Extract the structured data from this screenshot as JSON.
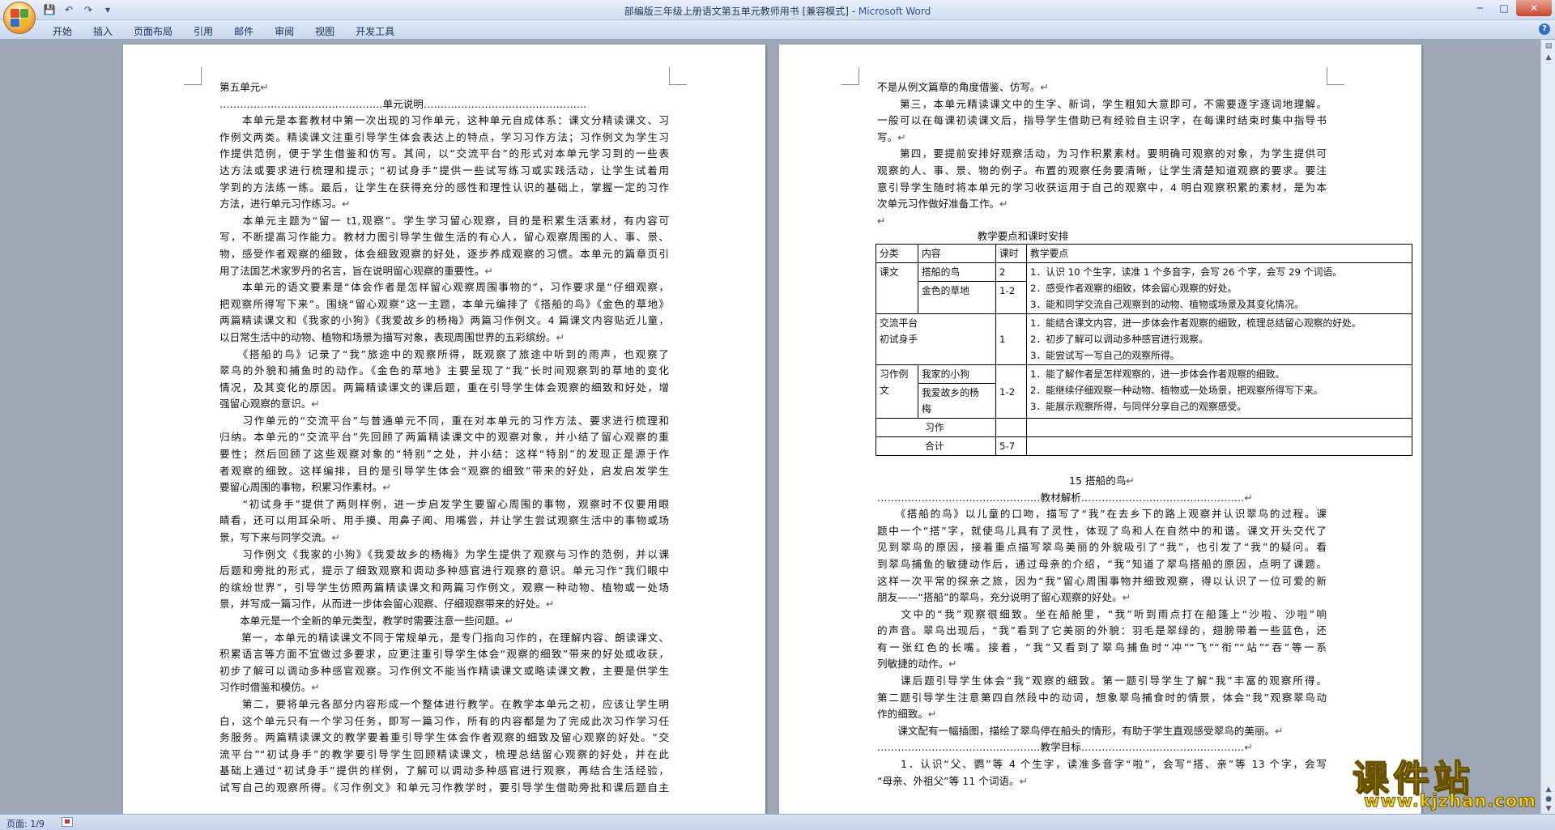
{
  "window": {
    "title_doc": "部编版三年级上册语文第五单元教师用书 [兼容模式] - ",
    "title_app": "Microsoft Word",
    "minimize": "─",
    "maximize": "□",
    "close": "✕"
  },
  "qat": {
    "save": "💾",
    "undo": "↶",
    "redo": "↷",
    "more": "▾"
  },
  "tabs": [
    "开始",
    "插入",
    "页面布局",
    "引用",
    "邮件",
    "审阅",
    "视图",
    "开发工具"
  ],
  "help": "?",
  "status": {
    "page": "页面: 1/9"
  },
  "watermark": {
    "text": "课件站",
    "url": "www.kjzhan.com"
  },
  "left_page": {
    "lines": [
      {
        "t": "第五单元",
        "c": "",
        "pm": true
      },
      {
        "t": "  …………………………………………单元说明…………………………………………",
        "c": "",
        "pm": false
      },
      {
        "t": "　　本单元是本套教材中第一次出现的习作单元，这种单元自成体系：课文分精读课文、习",
        "c": "jst",
        "pm": false
      },
      {
        "t": "作例文两类。精读课文注重引导学生体会表达上的特点，学习习作方法；习作例文为学生习",
        "c": "jst",
        "pm": false
      },
      {
        "t": "作提供范例，便于学生借鉴和仿写。其间，以“交流平台”的形式对本单元学习到的一些表",
        "c": "jst",
        "pm": false
      },
      {
        "t": "达方法或要求进行梳理和提示；“初试身手”提供一些试写练习或实践活动，让学生试着用",
        "c": "jst",
        "pm": false
      },
      {
        "t": "学到的方法练一练。最后，让学生在获得充分的感性和理性认识的基础上，掌握一定的习作",
        "c": "jst",
        "pm": false
      },
      {
        "t": "方法，进行单元习作练习。",
        "c": "",
        "pm": true
      },
      {
        "t": "　　本单元主题为“留一 t1,观察”。学生学习留心观察，目的是积累生活素材，有内容可",
        "c": "jst",
        "pm": false
      },
      {
        "t": "写，不断提高习作能力。教材力图引导学生做生活的有心人，留心观察周围的人、事、景、",
        "c": "jst",
        "pm": false
      },
      {
        "t": "物，感受作者观察的细致，体会细致观察的好处，逐步养成观察的习惯。本单元的篇章页引",
        "c": "jst",
        "pm": false
      },
      {
        "t": "用了法国艺术家罗丹的名言，旨在说明留心观察的重要性。",
        "c": "",
        "pm": true
      },
      {
        "t": "　　本单元的语文要素是“体会作者是怎样留心观察周围事物的”，习作要求是“仔细观察，",
        "c": "jst",
        "pm": false
      },
      {
        "t": "把观察所得写下来”。围绕“留心观察”这一主题，本单元编排了《搭船的鸟》《金色的草地》",
        "c": "jst",
        "pm": false
      },
      {
        "t": "两篇精读课文和《我家的小狗》《我爱故乡的杨梅》两篇习作例文。4 篇课文内容贴近儿童，",
        "c": "jst",
        "pm": false
      },
      {
        "t": "以日常生活中的动物、植物和场景为描写对象，表现周围世界的五彩缤纷。",
        "c": "",
        "pm": true
      },
      {
        "t": "　　《搭船的鸟》记录了“我”旅途中的观察所得，既观察了旅途中听到的雨声，也观察了",
        "c": "jst",
        "pm": false
      },
      {
        "t": "翠鸟的外貌和捕鱼时的动作。《金色的草地》主要呈现了“我”长时间观察到的草地的变化",
        "c": "jst",
        "pm": false
      },
      {
        "t": "情况，及其变化的原因。两篇精读课文的课后题，重在引导学生体会观察的细致和好处，增",
        "c": "jst",
        "pm": false
      },
      {
        "t": "强留心观察的意识。",
        "c": "",
        "pm": true
      },
      {
        "t": "　　习作单元的“交流平台”与普通单元不同，重在对本单元的习作方法、要求进行梳理和",
        "c": "jst",
        "pm": false
      },
      {
        "t": "归纳。本单元的“交流平台”先回顾了两篇精读课文中的观察对象，并小结了留心观察的重",
        "c": "jst",
        "pm": false
      },
      {
        "t": "要性；然后回顾了这些观察对象的“特别”之处，并小结：这样“特别”的发现正是源于作",
        "c": "jst",
        "pm": false
      },
      {
        "t": "者观察的细致。这样编排，目的是引导学生体会“观察的细致”带来的好处，启发启发学生",
        "c": "jst",
        "pm": false
      },
      {
        "t": "要留心周围的事物，积累习作素材。",
        "c": "",
        "pm": true
      },
      {
        "t": "　　“初试身手”提供了两则样例，进一步启发学生要留心周围的事物，观察时不仅要用眼",
        "c": "jst",
        "pm": false
      },
      {
        "t": "睛看，还可以用耳朵听、用手摸、用鼻子闻、用嘴尝，并让学生尝试观察生活中的事物或场",
        "c": "jst",
        "pm": false
      },
      {
        "t": "景，写下来与同学交流。",
        "c": "",
        "pm": true
      },
      {
        "t": "　　习作例文《我家的小狗》《我爱故乡的杨梅》为学生提供了观察与习作的范例，并以课",
        "c": "jst",
        "pm": false
      },
      {
        "t": "后题和旁批的形式，提示了细致观察和调动多种感官进行观察的意识。单元习作“我们眼中",
        "c": "jst",
        "pm": false
      },
      {
        "t": "的缤纷世界”，引导学生仿照两篇精读课文和两篇习作例文，观察一种动物、植物或一处场",
        "c": "jst",
        "pm": false
      },
      {
        "t": "景，并写成一篇习作，从而进一步体会留心观察、仔细观察带来的好处。",
        "c": "",
        "pm": true
      },
      {
        "t": "　　本单元是一个全新的单元类型，教学时需要注意一些问题。",
        "c": "",
        "pm": true
      },
      {
        "t": "　　第一，本单元的精读课文不同于常规单元，是专门指向习作的，在理解内容、朗读课文、",
        "c": "jst",
        "pm": false
      },
      {
        "t": "积累语言等方面不宜做过多要求，应更注重引导学生体会“观察的细致”带来的好处或收获，",
        "c": "jst",
        "pm": false
      },
      {
        "t": "初步了解可以调动多种感官观察。习作例文不能当作精读课文或略读课文教，主要是供学生",
        "c": "jst",
        "pm": false
      },
      {
        "t": "习作时借鉴和模仿。",
        "c": "",
        "pm": true
      },
      {
        "t": "　　第二，要将单元各部分内容形成一个整体进行教学。在教学本单元之初，应该让学生明",
        "c": "jst",
        "pm": false
      },
      {
        "t": "白，这个单元只有一个学习任务，即写一篇习作，所有的内容都是为了完成此次习作学习任",
        "c": "jst",
        "pm": false
      },
      {
        "t": "务服务。两篇精读课文的教学要着重引导学生体会作者观察的细致及留心观察的好处。“交",
        "c": "jst",
        "pm": false
      },
      {
        "t": "流平台”“初试身手”的教学要引导学生回顾精读课文，梳理总结留心观察的好处，并在此",
        "c": "jst",
        "pm": false
      },
      {
        "t": "基础上通过“初试身手”提供的样例，了解可以调动多种感官进行观察，再结合生活经验，",
        "c": "jst",
        "pm": false
      },
      {
        "t": "试写自己的观察所得。《习作例文》和单元习作教学时，要引导学生借助旁批和课后题自主",
        "c": "jst",
        "pm": false
      }
    ]
  },
  "right_page": {
    "lines_before": [
      {
        "t": "不是从例文篇章的角度借鉴、仿写。",
        "c": "",
        "pm": true
      },
      {
        "t": "　　第三，本单元精读课文中的生字、新词，学生粗知大意即可，不需要逐字逐词地理解。",
        "c": "jst",
        "pm": false
      },
      {
        "t": "一般可以在每课初读课文后，指导学生借助已有经验自主识字，在每课时结束时集中指导书",
        "c": "jst",
        "pm": false
      },
      {
        "t": "写。",
        "c": "",
        "pm": true
      },
      {
        "t": "　　第四，要提前安排好观察活动，为习作积累素材。要明确可观察的对象，为学生提供可",
        "c": "jst",
        "pm": false
      },
      {
        "t": "观察的人、事、景、物的例子。布置的观察任务要清晰，让学生清楚知道观察的要求。要注",
        "c": "jst",
        "pm": false
      },
      {
        "t": "意引导学生随时将本单元的学习收获运用于自己的观察中，4 明白观察积累的素材，是为本",
        "c": "jst",
        "pm": false
      },
      {
        "t": "次单元习作做好准备工作。",
        "c": "",
        "pm": true
      },
      {
        "t": "",
        "c": "",
        "pm": true
      }
    ],
    "table_title": "教学要点和课时安排",
    "table": {
      "headers": [
        "分类",
        "内容",
        "课时",
        "教学要点"
      ],
      "r1": {
        "cat": "课文",
        "c1": "搭船的鸟",
        "h1": "2",
        "c2": "金色的草地",
        "h2": "1-2",
        "pts": [
          "1．认识 10 个生字，读准 1 个多音字，会写 26 个字，会写 29 个词语。",
          "2．感受作者观察的细致，体会留心观察的好处。",
          "3．能和同学交流自己观察到的动物、植物或场景及其变化情况。"
        ]
      },
      "r2": {
        "cat1": "交流平台",
        "cat2": "初试身手",
        "h": "1",
        "pts": [
          "1．能结合课文内容，进一步体会作者观察的细致，梳理总结留心观察的好处。",
          "2．初步了解可以调动多种感官进行观察。",
          "3．能尝试写一写自己的观察所得。"
        ]
      },
      "r3": {
        "cat1": "习作例",
        "cat2": "文",
        "c1": "我家的小狗",
        "c2a": "我爱故乡的杨",
        "c2b": "梅",
        "h": "1-2",
        "pts": [
          "1．能了解作者是怎样观察的，进一步体会作者观察的细致。",
          "2．能继续仔细观察一种动物、植物或一处场景，把观察所得写下来。",
          "3．能展示观察所得，与同伴分享自己的观察感受。"
        ]
      },
      "r4": {
        "c": "习作"
      },
      "r5": {
        "c": "合计",
        "h": "5-7"
      }
    },
    "lines_after": [
      {
        "t": "",
        "c": "",
        "pm": false
      },
      {
        "t": "15 搭船的鸟",
        "c": "ctr",
        "pm": true
      },
      {
        "t": "…………………………………………教材解析…………………………………………",
        "c": "",
        "pm": true
      },
      {
        "t": "　　《搭船的鸟》以儿童的口吻，描写了“我”在去乡下的路上观察并认识翠鸟的过程。课",
        "c": "jst",
        "pm": false
      },
      {
        "t": "题中一个“搭”字，就使鸟儿具有了灵性，体现了鸟和人在自然中的和谐。课文开头交代了",
        "c": "jst",
        "pm": false
      },
      {
        "t": "见到翠鸟的原因，接着重点描写翠鸟美丽的外貌吸引了“我”，也引发了“我”的疑问。看",
        "c": "jst",
        "pm": false
      },
      {
        "t": "到翠鸟捕鱼的敏捷动作后，通过母亲的介绍，“我”知道了翠鸟搭船的原因，点明了课题。",
        "c": "jst",
        "pm": false
      },
      {
        "t": "这样一次平常的探亲之旅，因为“我”留心周围事物并细致观察，得以认识了一位可爱的新",
        "c": "jst",
        "pm": false
      },
      {
        "t": "朋友——“搭船”的翠鸟，充分说明了留心观察的好处。",
        "c": "",
        "pm": true
      },
      {
        "t": "　　文中的“我”观察很细致。坐在船舱里，“我”听到雨点打在船篷上“沙啦、沙啦”响",
        "c": "jst",
        "pm": false
      },
      {
        "t": "的声音。翠鸟出现后，“我”看到了它美丽的外貌：羽毛是翠绿的，翅膀带着一些蓝色，还",
        "c": "jst",
        "pm": false
      },
      {
        "t": "有一张红色的长嘴。接着，“我”又看到了翠鸟捕鱼时“冲”“飞”“衔”“站”“吞”等一系",
        "c": "jst",
        "pm": false
      },
      {
        "t": "列敏捷的动作。",
        "c": "",
        "pm": true
      },
      {
        "t": "　　课后题引导学生体会“我”观察的细致。第一题引导学生了解“我”丰富的观察所得。",
        "c": "jst",
        "pm": false
      },
      {
        "t": "第二题引导学生注意第四自然段中的动词，想象翠鸟捕食时的情景，体会“我”观察翠鸟动",
        "c": "jst",
        "pm": false
      },
      {
        "t": "作的细致。",
        "c": "",
        "pm": true
      },
      {
        "t": "　　课文配有一幅插图，描绘了翠鸟停在船头的情形，有助于学生直观感受翠鸟的美丽。",
        "c": "",
        "pm": true
      },
      {
        "t": "…………………………………………教学目标…………………………………………",
        "c": "",
        "pm": true
      },
      {
        "t": "　　1．认识“父、鹦”等 4 个生字，读准多音字“啦”，会写“搭、亲”等 13 个字，会写",
        "c": "jst",
        "pm": false
      },
      {
        "t": "“母亲、外祖父”等 11 个词语。",
        "c": "",
        "pm": true
      }
    ]
  }
}
